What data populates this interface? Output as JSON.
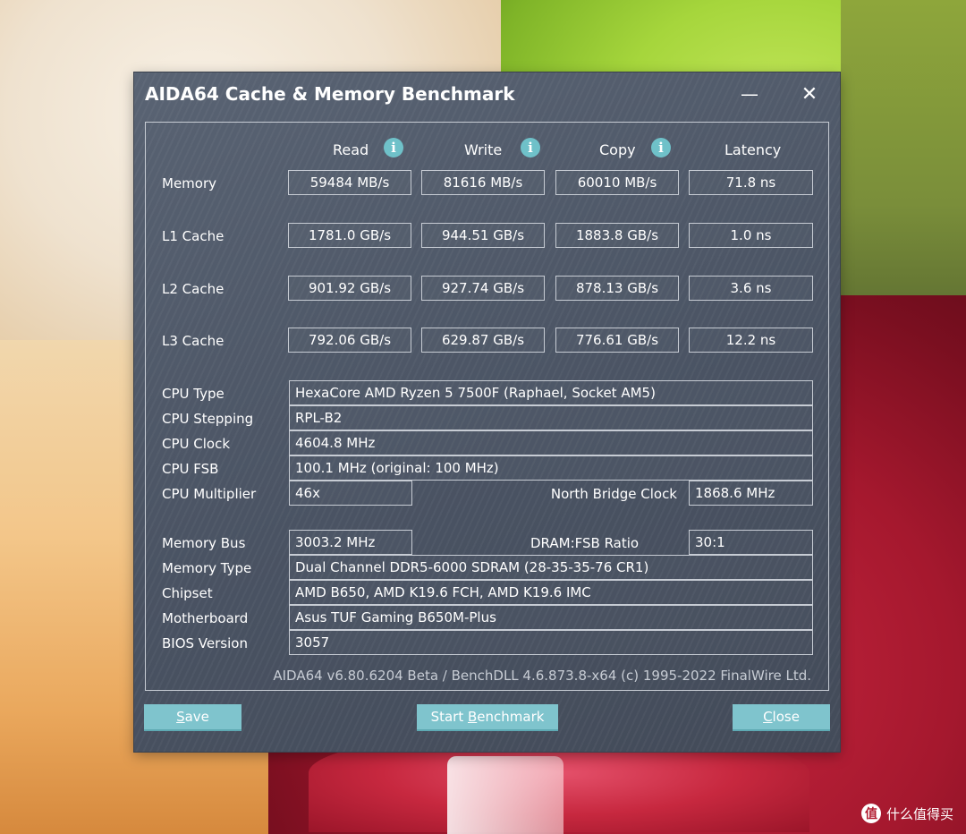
{
  "window": {
    "title": "AIDA64 Cache & Memory Benchmark",
    "minimize_glyph": "—",
    "close_glyph": "✕"
  },
  "columns": {
    "read": "Read",
    "write": "Write",
    "copy": "Copy",
    "latency": "Latency",
    "info_glyph": "i"
  },
  "rows": [
    {
      "label": "Memory",
      "read": "59484 MB/s",
      "write": "81616 MB/s",
      "copy": "60010 MB/s",
      "latency": "71.8 ns"
    },
    {
      "label": "L1 Cache",
      "read": "1781.0 GB/s",
      "write": "944.51 GB/s",
      "copy": "1883.8 GB/s",
      "latency": "1.0 ns"
    },
    {
      "label": "L2 Cache",
      "read": "901.92 GB/s",
      "write": "927.74 GB/s",
      "copy": "878.13 GB/s",
      "latency": "3.6 ns"
    },
    {
      "label": "L3 Cache",
      "read": "792.06 GB/s",
      "write": "629.87 GB/s",
      "copy": "776.61 GB/s",
      "latency": "12.2 ns"
    }
  ],
  "cpu": {
    "type_label": "CPU Type",
    "type_value": "HexaCore AMD Ryzen 5 7500F  (Raphael, Socket AM5)",
    "stepping_label": "CPU Stepping",
    "stepping_value": "RPL-B2",
    "clock_label": "CPU Clock",
    "clock_value": "4604.8 MHz",
    "fsb_label": "CPU FSB",
    "fsb_value": "100.1 MHz  (original: 100 MHz)",
    "multiplier_label": "CPU Multiplier",
    "multiplier_value": "46x",
    "nb_clock_label": "North Bridge Clock",
    "nb_clock_value": "1868.6 MHz"
  },
  "memory": {
    "bus_label": "Memory Bus",
    "bus_value": "3003.2 MHz",
    "ratio_label": "DRAM:FSB Ratio",
    "ratio_value": "30:1",
    "type_label": "Memory Type",
    "type_value": "Dual Channel DDR5-6000 SDRAM  (28-35-35-76 CR1)",
    "chipset_label": "Chipset",
    "chipset_value": "AMD B650, AMD K19.6 FCH, AMD K19.6 IMC",
    "motherboard_label": "Motherboard",
    "motherboard_value": "Asus TUF Gaming B650M-Plus",
    "bios_label": "BIOS Version",
    "bios_value": "3057"
  },
  "footer_note": "AIDA64 v6.80.6204 Beta / BenchDLL 4.6.873.8-x64  (c) 1995-2022 FinalWire Ltd.",
  "buttons": {
    "save_u": "S",
    "save_rest": "ave",
    "start_pre": "Start ",
    "start_u": "B",
    "start_rest": "enchmark",
    "close_u": "C",
    "close_rest": "lose"
  },
  "watermark": {
    "logo_glyph": "值",
    "text": "什么值得买"
  }
}
